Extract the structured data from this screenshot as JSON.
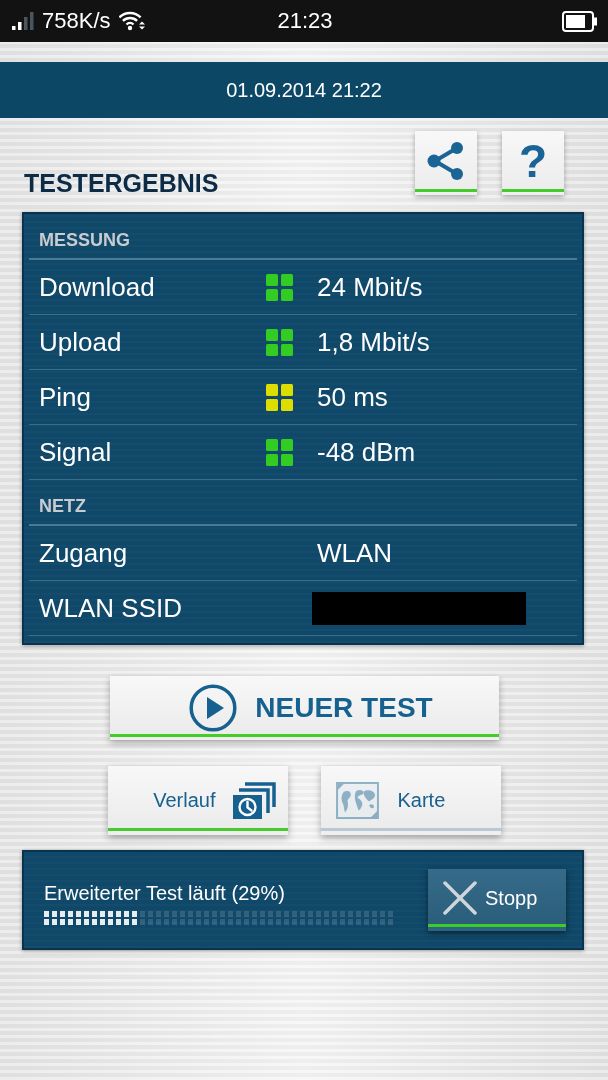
{
  "status_bar": {
    "speed": "758K/s",
    "time": "21:23"
  },
  "header": {
    "datetime": "01.09.2014 21:22"
  },
  "title": "TESTERGEBNIS",
  "actions": [
    {
      "kind": "share"
    },
    {
      "kind": "help",
      "label": "?"
    }
  ],
  "results": {
    "sections": [
      {
        "heading": "MESSUNG",
        "rows": [
          {
            "kind": "rated",
            "label": "Download",
            "value": "24 Mbit/s",
            "color": "#33cc22"
          },
          {
            "kind": "rated",
            "label": "Upload",
            "value": "1,8 Mbit/s",
            "color": "#33cc22"
          },
          {
            "kind": "rated",
            "label": "Ping",
            "value": "50 ms",
            "color": "#dddd00"
          },
          {
            "kind": "rated",
            "label": "Signal",
            "value": "-48 dBm",
            "color": "#33cc22"
          }
        ]
      },
      {
        "heading": "NETZ",
        "rows": [
          {
            "kind": "text",
            "label": "Zugang",
            "value": "WLAN"
          },
          {
            "kind": "redacted",
            "label": "WLAN SSID"
          }
        ]
      }
    ]
  },
  "main_button": {
    "label": "NEUER TEST"
  },
  "nav_buttons": [
    {
      "kind": "history",
      "label": "Verlauf",
      "disabled": false
    },
    {
      "kind": "map",
      "label": "Karte",
      "disabled": true
    }
  ],
  "progress": {
    "label": "Erweiterter Test läuft (29%)",
    "level": 0.29
  },
  "stop_button": {
    "label": "Stopp"
  }
}
